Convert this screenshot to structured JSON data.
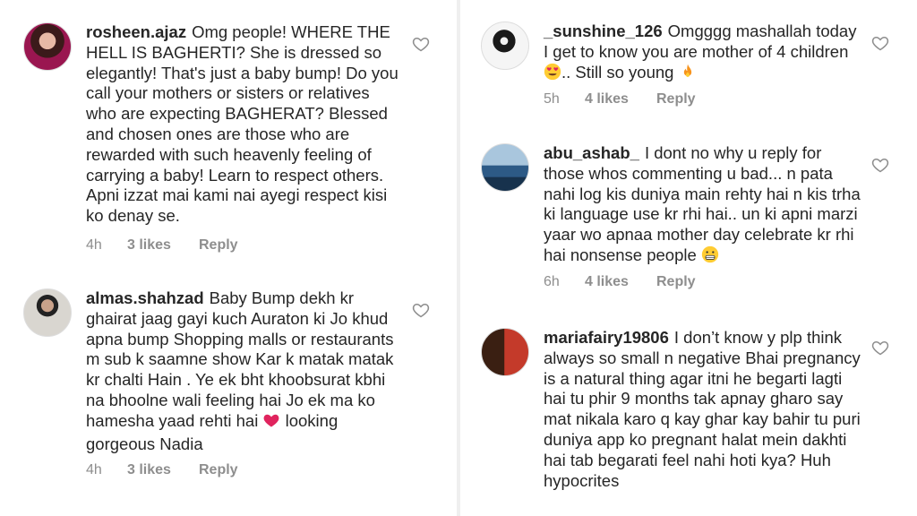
{
  "left_panel": {
    "comments": [
      {
        "username": "rosheen.ajaz",
        "text": "Omg people! WHERE THE HELL IS BAGHERTI? She is dressed so elegantly! That's just a baby bump! Do you call your mothers or sisters or relatives who are expecting BAGHERAT? Blessed and chosen ones are those who are rewarded with such heavenly feeling of carrying a baby! Learn to respect others. Apni izzat mai kami nai ayegi respect kisi ko denay se.",
        "time": "4h",
        "likes": "3 likes",
        "reply": "Reply"
      },
      {
        "username": "almas.shahzad",
        "text": "Baby Bump dekh kr ghairat jaag gayi kuch Auraton ki Jo khud apna bump Shopping malls or restaurants  m sub k saamne show Kar k matak matak kr chalti Hain . Ye ek bht khoobsurat  kbhi na bhoolne wali feeling hai Jo ek ma ko hamesha yaad rehti hai",
        "text_after_emoji": " looking gorgeous Nadia",
        "time": "4h",
        "likes": "3 likes",
        "reply": "Reply"
      }
    ]
  },
  "right_panel": {
    "comments": [
      {
        "username": "_sunshine_126",
        "text": "Omgggg mashallah today I get to know you are mother of 4 children",
        "text_mid": ".. Still so young",
        "time": "5h",
        "likes": "4 likes",
        "reply": "Reply"
      },
      {
        "username": "abu_ashab_",
        "text": "I dont no why u reply for those whos commenting u bad... n pata nahi log kis duniya main rehty hai n kis trha ki language use kr rhi hai.. un ki apni marzi yaar wo apnaa mother day celebrate kr rhi hai nonsense people",
        "time": "6h",
        "likes": "4 likes",
        "reply": "Reply"
      },
      {
        "username": "mariafairy19806",
        "text": "I don’t know y plp think always so small n negative Bhai pregnancy is a natural thing agar itni he begarti lagti hai tu phir 9 months tak apnay gharo say mat nikala karo q kay ghar kay bahir tu puri duniya app ko pregnant halat mein dakhti hai tab begarati feel nahi hoti kya? Huh hypocrites"
      }
    ]
  },
  "colors": {
    "text": "#262626",
    "meta": "#8e8e8e",
    "heart_emoji": "#e0245e"
  }
}
